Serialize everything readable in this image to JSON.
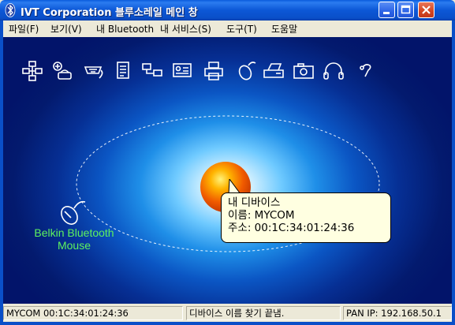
{
  "window": {
    "title": "IVT Corporation 블루소레일 메인 창"
  },
  "menu": {
    "items": [
      "파일(F)",
      "보기(V)",
      "내 Bluetooth",
      "내 서비스(S)",
      "도구(T)",
      "도움말"
    ]
  },
  "toolbar": {
    "icons": [
      "network-icon",
      "dialup-icon",
      "serial-port-icon",
      "file-transfer-icon",
      "lan-access-icon",
      "business-card-icon",
      "printer-icon",
      "mouse-icon",
      "fax-icon",
      "camera-icon",
      "headphones-icon",
      "headset-icon"
    ]
  },
  "device": {
    "label_line1": "Belkin Bluetooth",
    "label_line2": "Mouse"
  },
  "tooltip": {
    "line1": "내 디바이스",
    "line2": "이름: MYCOM",
    "line3": "주소: 00:1C:34:01:24:36"
  },
  "status": {
    "pane1": "MYCOM 00:1C:34:01:24:36",
    "pane2": "디바이스 이름 찾기 끝냄.",
    "pane3": "PAN IP: 192.168.50.1"
  },
  "colors": {
    "titlebar": "#0a4fc8",
    "canvas_center": "#ffffff",
    "canvas_edge": "#02146a",
    "device_label": "#5ef25e",
    "tooltip_bg": "#ffffe1"
  }
}
